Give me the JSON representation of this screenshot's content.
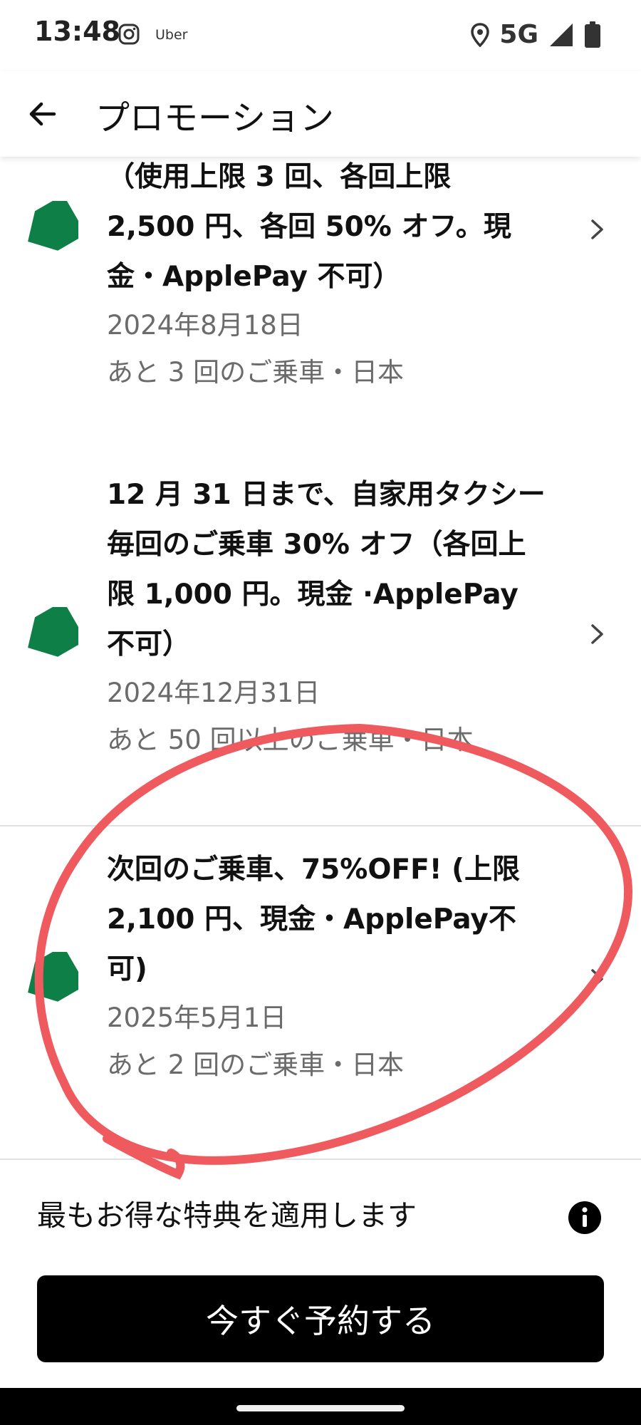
{
  "status_bar": {
    "time": "13:48",
    "app_label": "Uber",
    "network": "5G",
    "icons": [
      "instagram-icon",
      "location-pin-icon",
      "signal-icon",
      "battery-icon"
    ]
  },
  "header": {
    "title": "プロモーション",
    "back_icon": "arrow-left-icon"
  },
  "promotions": [
    {
      "title": "（使用上限 3 回、各回上限 2,500 円、各回 50% オフ。現金・ApplePay 不可）",
      "date": "2024年8月18日",
      "meta": "あと 3 回のご乗車・日本"
    },
    {
      "title": "12 月 31 日まで、自家用タクシー毎回のご乗車 30% オフ（各回上限 1,000 円。現金 ·ApplePay 不可）",
      "date": "2024年12月31日",
      "meta": "あと 50 回以上のご乗車・日本"
    },
    {
      "title": "次回のご乗車、75%OFF! (上限 2,100 円、現金・ApplePay不可)",
      "date": "2025年5月1日",
      "meta": "あと 2 回のご乗車・日本"
    }
  ],
  "footer": {
    "best_offer_text": "最もお得な特典を適用します",
    "info_icon": "info-icon",
    "book_button": "今すぐ予約する"
  },
  "colors": {
    "tag_green": "#0e7f46",
    "annotation_red": "#ef5a5f",
    "button_black": "#000000",
    "secondary_text": "#6b6b6b"
  }
}
